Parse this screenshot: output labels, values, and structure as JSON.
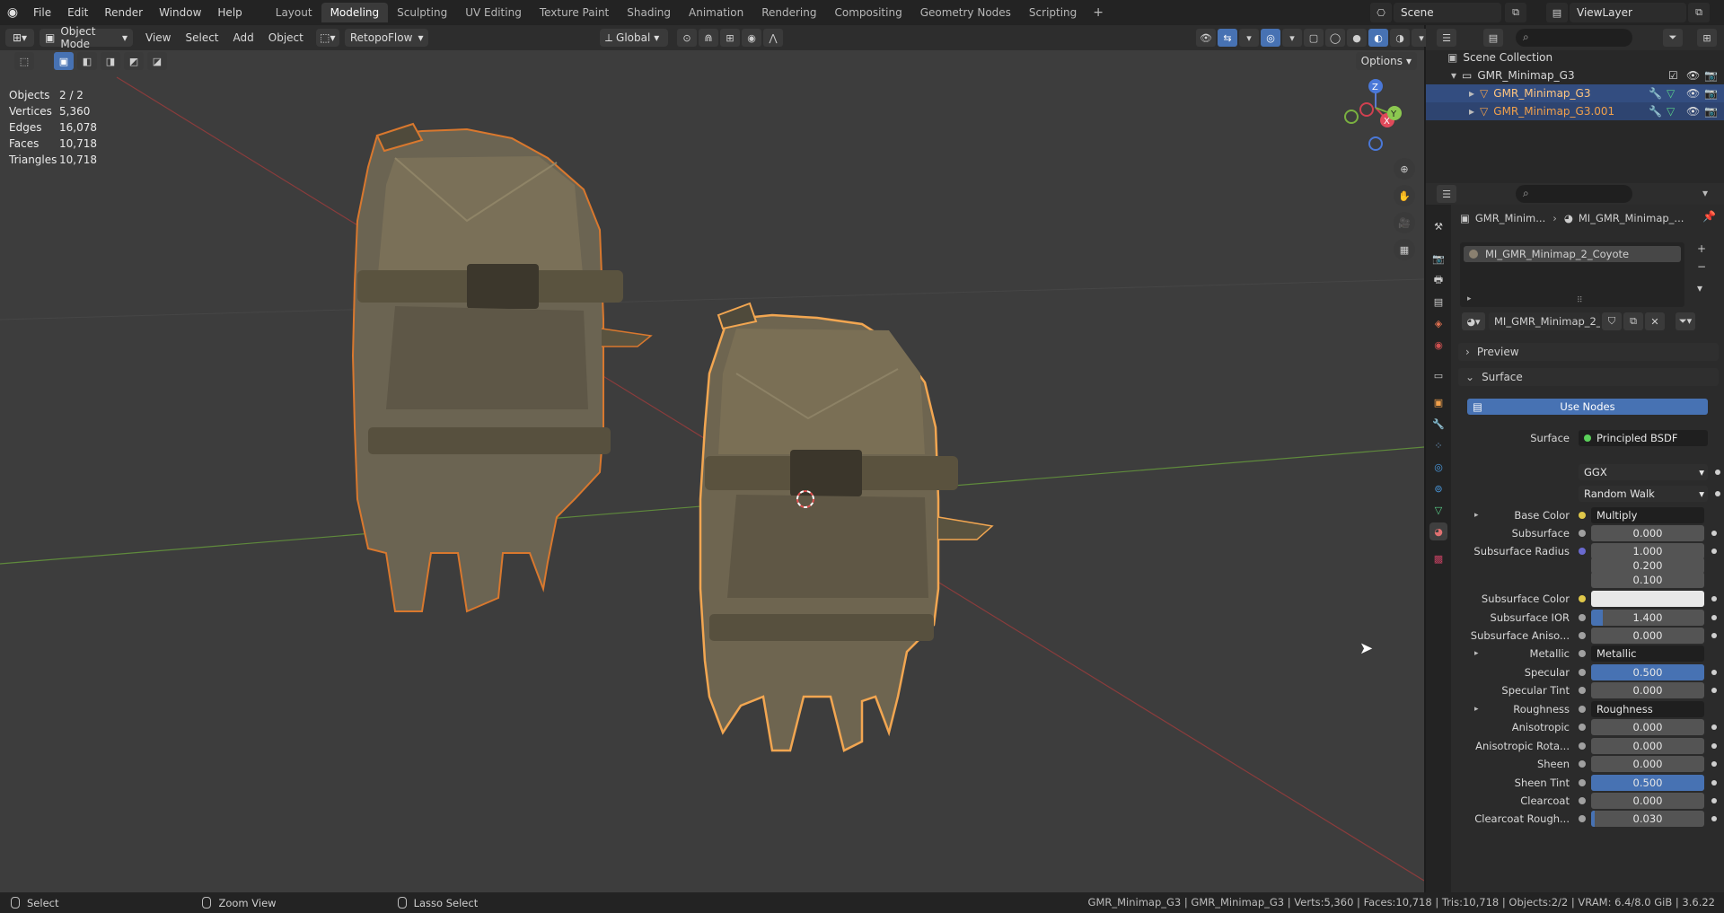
{
  "topbar": {
    "menu": [
      "File",
      "Edit",
      "Render",
      "Window",
      "Help"
    ],
    "workspaces": [
      "Layout",
      "Modeling",
      "Sculpting",
      "UV Editing",
      "Texture Paint",
      "Shading",
      "Animation",
      "Rendering",
      "Compositing",
      "Geometry Nodes",
      "Scripting"
    ],
    "active_workspace": "Modeling",
    "add_workspace": "+",
    "scene": "Scene",
    "view_layer": "ViewLayer"
  },
  "viewport_header": {
    "mode": "Object Mode",
    "menus": [
      "View",
      "Select",
      "Add",
      "Object"
    ],
    "addon": "RetopoFlow",
    "orientation": "Global",
    "options": "Options"
  },
  "stats": [
    {
      "label": "Objects",
      "value": "2 / 2"
    },
    {
      "label": "Vertices",
      "value": "5,360"
    },
    {
      "label": "Edges",
      "value": "16,078"
    },
    {
      "label": "Faces",
      "value": "10,718"
    },
    {
      "label": "Triangles",
      "value": "10,718"
    }
  ],
  "gizmo": {
    "x": "X",
    "y": "Y",
    "z": "Z"
  },
  "outliner": {
    "collection": "Scene Collection",
    "group": "GMR_Minimap_G3",
    "objects": [
      "GMR_Minimap_G3",
      "GMR_Minimap_G3.001"
    ]
  },
  "properties": {
    "breadcrumb_object": "GMR_Minim...",
    "breadcrumb_material": "MI_GMR_Minimap_...",
    "slot_name": "MI_GMR_Minimap_2_Coyote",
    "material_name": "MI_GMR_Minimap_2_Coyote",
    "panel_preview": "Preview",
    "panel_surface": "Surface",
    "use_nodes": "Use Nodes",
    "surface_label": "Surface",
    "surface_value": "Principled BSDF",
    "distribution": "GGX",
    "subsurface_method": "Random Walk",
    "rows": [
      {
        "label": "Base Color",
        "value": "Multiply",
        "kind": "link",
        "dot": "#e0c84a",
        "expand": true
      },
      {
        "label": "Subsurface",
        "value": "0.000",
        "kind": "num",
        "dot": "#a0a0a0"
      },
      {
        "label": "Subsurface Radius",
        "value": "1.000",
        "kind": "num",
        "dot": "#6a6ad0"
      },
      {
        "label": "",
        "value": "0.200",
        "kind": "num"
      },
      {
        "label": "",
        "value": "0.100",
        "kind": "num"
      },
      {
        "label": "Subsurface Color",
        "value": "",
        "kind": "color",
        "dot": "#e0c84a"
      },
      {
        "label": "Subsurface IOR",
        "value": "1.400",
        "kind": "num",
        "dot": "#a0a0a0",
        "fill": 0.1
      },
      {
        "label": "Subsurface Aniso...",
        "value": "0.000",
        "kind": "num",
        "dot": "#a0a0a0"
      },
      {
        "label": "Metallic",
        "value": "Metallic",
        "kind": "link",
        "dot": "#a0a0a0",
        "expand": true
      },
      {
        "label": "Specular",
        "value": "0.500",
        "kind": "num",
        "dot": "#a0a0a0",
        "fill": 1.0
      },
      {
        "label": "Specular Tint",
        "value": "0.000",
        "kind": "num",
        "dot": "#a0a0a0"
      },
      {
        "label": "Roughness",
        "value": "Roughness",
        "kind": "link",
        "dot": "#a0a0a0",
        "expand": true
      },
      {
        "label": "Anisotropic",
        "value": "0.000",
        "kind": "num",
        "dot": "#a0a0a0"
      },
      {
        "label": "Anisotropic Rota...",
        "value": "0.000",
        "kind": "num",
        "dot": "#a0a0a0"
      },
      {
        "label": "Sheen",
        "value": "0.000",
        "kind": "num",
        "dot": "#a0a0a0"
      },
      {
        "label": "Sheen Tint",
        "value": "0.500",
        "kind": "num",
        "dot": "#a0a0a0",
        "fill": 1.0
      },
      {
        "label": "Clearcoat",
        "value": "0.000",
        "kind": "num",
        "dot": "#a0a0a0"
      },
      {
        "label": "Clearcoat Rough...",
        "value": "0.030",
        "kind": "num",
        "dot": "#a0a0a0",
        "fill": 0.03
      }
    ]
  },
  "statusbar": {
    "select": "Select",
    "zoom": "Zoom View",
    "lasso": "Lasso Select",
    "info": "GMR_Minimap_G3 | GMR_Minimap_G3 | Verts:5,360 | Faces:10,718 | Tris:10,718 | Objects:2/2 | VRAM: 6.4/8.0 GiB | 3.6.22"
  },
  "colors": {
    "accent": "#4772b3",
    "selection_outline": "#f0a04b",
    "active_outline": "#ffb347"
  }
}
